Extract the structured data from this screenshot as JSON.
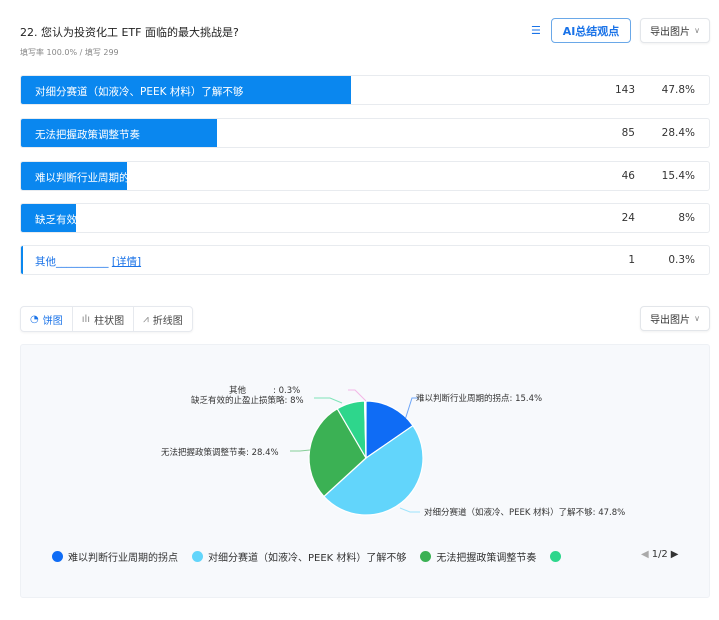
{
  "header": {
    "title": "22. 您认为投资化工 ETF 面临的最大挑战是?",
    "subtitle": "填写率 100.0% / 填写 299",
    "ai_button": "AI总结观点",
    "export_label": "导出图片",
    "list_icon": "list-icon"
  },
  "rows": [
    {
      "label": "对细分赛道（如液冷、PEEK 材料）了解不够",
      "count": "143",
      "percent": "47.8%",
      "value": 47.8
    },
    {
      "label": "无法把握政策调整节奏",
      "count": "85",
      "percent": "28.4%",
      "value": 28.4
    },
    {
      "label": "难以判断行业周期的拐点",
      "count": "46",
      "percent": "15.4%",
      "value": 15.4
    },
    {
      "label": "缺乏有效的止盈止损策略",
      "count": "24",
      "percent": "8%",
      "value": 8
    },
    {
      "label": "其他__________",
      "detail": "[详情]",
      "count": "1",
      "percent": "0.3%",
      "value": 0.3
    }
  ],
  "tabs": [
    {
      "label": "饼图",
      "icon": "pie-icon"
    },
    {
      "label": "柱状图",
      "icon": "bar-chart-icon"
    },
    {
      "label": "折线图",
      "icon": "line-chart-icon"
    }
  ],
  "chart_export_label": "导出图片",
  "chart_data": {
    "type": "pie",
    "slices": [
      {
        "name": "难以判断行业周期的拐点",
        "value": 15.4,
        "label": "难以判断行业周期的拐点: 15.4%",
        "color": "#0f6cf5"
      },
      {
        "name": "对细分赛道（如液冷、PEEK 材料）了解不够",
        "value": 47.8,
        "label": "对细分赛道（如液冷、PEEK 材料）了解不够: 47.8%",
        "color": "#62d5fb"
      },
      {
        "name": "无法把握政策调整节奏",
        "value": 28.4,
        "label": "无法把握政策调整节奏: 28.4%",
        "color": "#3bb154"
      },
      {
        "name": "缺乏有效的止盈止损策略",
        "value": 8,
        "label": "缺乏有效的止盈止损策略: 8%",
        "color": "#2ed68c"
      },
      {
        "name": "其他",
        "value": 0.3,
        "label": "其他          : 0.3%",
        "color": "#f08ad8"
      }
    ],
    "legend": [
      "难以判断行业周期的拐点",
      "对细分赛道（如液冷、PEEK 材料）了解不够",
      "无法把握政策调整节奏",
      ""
    ],
    "legend_page": "1/2"
  }
}
